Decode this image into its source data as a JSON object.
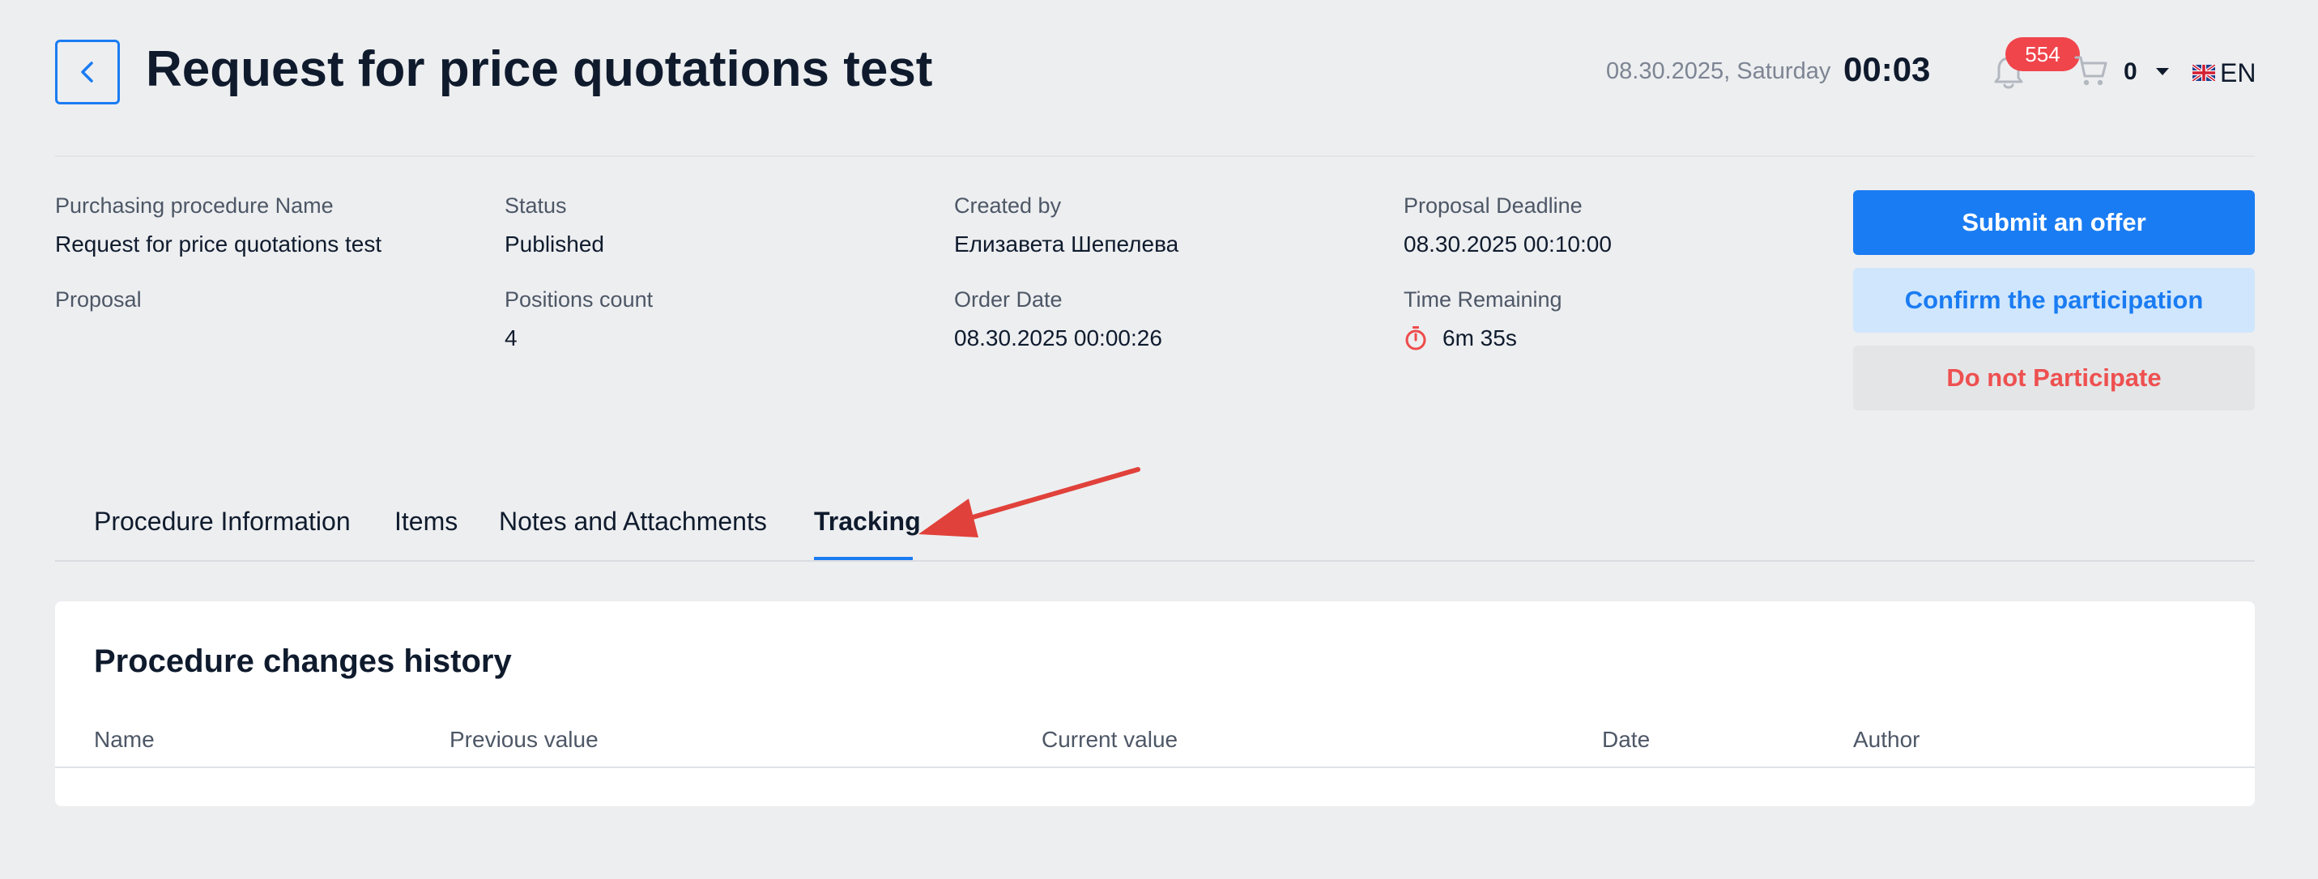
{
  "header": {
    "title": "Request for price quotations test",
    "date": "08.30.2025, Saturday",
    "time": "00:03",
    "notifications_count": "554",
    "cart_count": "0",
    "language": "EN"
  },
  "info": {
    "purchasing_name_label": "Purchasing procedure Name",
    "purchasing_name_value": "Request for price quotations test",
    "status_label": "Status",
    "status_value": "Published",
    "created_by_label": "Created by",
    "created_by_value": "Елизавета Шепелева",
    "deadline_label": "Proposal Deadline",
    "deadline_value": "08.30.2025 00:10:00",
    "proposal_label": "Proposal",
    "positions_label": "Positions count",
    "positions_value": "4",
    "order_date_label": "Order Date",
    "order_date_value": "08.30.2025 00:00:26",
    "time_remaining_label": "Time Remaining",
    "time_remaining_value": "6m 35s"
  },
  "actions": {
    "submit": "Submit an offer",
    "confirm": "Confirm the participation",
    "decline": "Do not Participate"
  },
  "tabs": [
    {
      "label": "Procedure Information"
    },
    {
      "label": "Items"
    },
    {
      "label": "Notes and Attachments"
    },
    {
      "label": "Tracking",
      "active": true
    }
  ],
  "history": {
    "title": "Procedure changes history",
    "columns": [
      "Name",
      "Previous value",
      "Current value",
      "Date",
      "Author"
    ],
    "rows": []
  },
  "colors": {
    "accent": "#1a7cf2",
    "danger": "#ee5050",
    "badge": "#f0454b",
    "annotation_arrow": "#e0413a"
  },
  "icons": {
    "back": "chevron-left-icon",
    "notifications": "bell-icon",
    "cart": "cart-icon",
    "language_flag": "uk-flag-icon",
    "timer": "stopwatch-icon"
  }
}
